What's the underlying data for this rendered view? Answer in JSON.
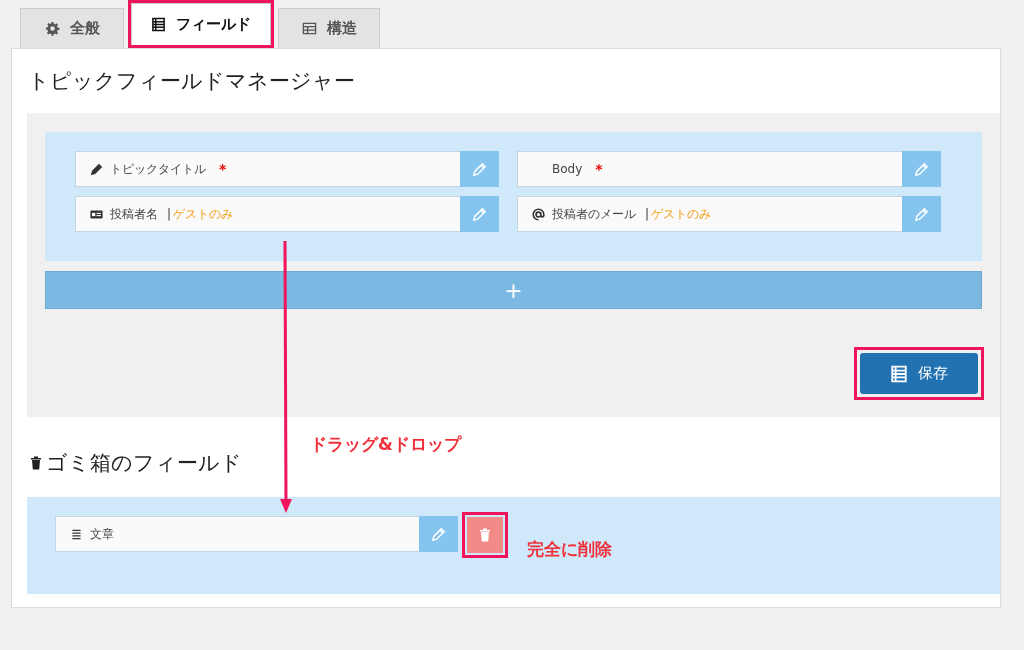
{
  "tabs": [
    {
      "label": "全般",
      "kind": "gear",
      "selected": false,
      "highlighted": false
    },
    {
      "label": "フィールド",
      "kind": "list",
      "selected": true,
      "highlighted": true
    },
    {
      "label": "構造",
      "kind": "grid",
      "selected": false,
      "highlighted": false
    }
  ],
  "manager": {
    "title": "トピックフィールドマネージャー",
    "fields": [
      {
        "label": "トピックタイトル",
        "kind": "pencil",
        "required_mark": "*"
      },
      {
        "label": "Body",
        "kind": "plain",
        "required_mark": "*"
      },
      {
        "label": "投稿者名",
        "kind": "card",
        "note": {
          "separator": "|",
          "text": "ゲストのみ"
        }
      },
      {
        "label": "投稿者のメール",
        "kind": "email",
        "note": {
          "separator": "|",
          "text": "ゲストのみ"
        }
      }
    ],
    "add_button": "+",
    "save_button": {
      "label": "保存",
      "highlighted": true
    }
  },
  "trash": {
    "title": "ゴミ箱のフィールド",
    "fields": [
      {
        "label": "文章",
        "kind": "text",
        "delete_highlighted": true
      }
    ]
  },
  "annotations": [
    {
      "kind": "drag",
      "text": "ドラッグ&ドロップ"
    },
    {
      "kind": "delete",
      "text": "完全に削除"
    }
  ]
}
